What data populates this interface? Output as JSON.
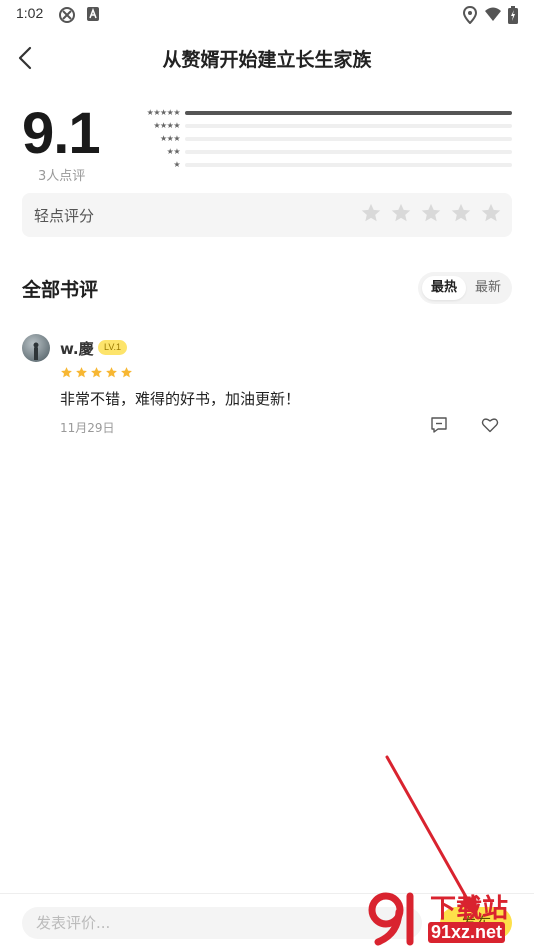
{
  "status_bar": {
    "time": "1:02",
    "icons": [
      "sync-icon",
      "a-badge-icon",
      "location-icon",
      "wifi-icon",
      "battery-icon"
    ]
  },
  "header": {
    "title": "从赘婿开始建立长生家族",
    "back_icon": "chevron-left-icon"
  },
  "rating": {
    "score": "9.1",
    "count_text": "3人点评",
    "distribution": [
      {
        "stars": 5,
        "fraction": 1.0
      },
      {
        "stars": 4,
        "fraction": 0.0
      },
      {
        "stars": 3,
        "fraction": 0.0
      },
      {
        "stars": 2,
        "fraction": 0.0
      },
      {
        "stars": 1,
        "fraction": 0.0
      }
    ],
    "tap_to_rate_label": "轻点评分",
    "tap_to_rate_stars": 5
  },
  "reviews_section": {
    "title": "全部书评",
    "sort_options": [
      {
        "label": "最热",
        "active": true
      },
      {
        "label": "最新",
        "active": false
      }
    ]
  },
  "reviews": [
    {
      "user": "w.慶",
      "level": "LV.1",
      "stars": 5,
      "text": "非常不错，难得的好书，加油更新！",
      "date": "11月29日"
    }
  ],
  "bottom_bar": {
    "placeholder": "发表评价...",
    "publish_label": "发布"
  },
  "watermark": {
    "top": "下载站",
    "bottom": "91xz.net"
  },
  "colors": {
    "accent_yellow": "#fde04a",
    "star_orange": "#f7b733",
    "star_empty": "#d9d9d9",
    "annotation_red": "#d9232f"
  }
}
